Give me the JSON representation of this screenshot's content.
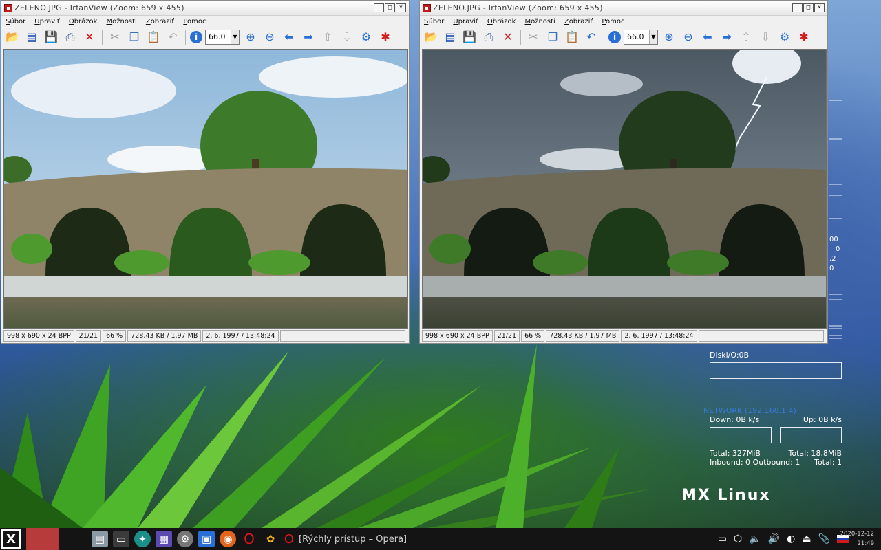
{
  "windows": [
    {
      "id": "left",
      "title": "ZELENO.JPG - IrfanView (Zoom: 659 x 455)",
      "menu": [
        "Súbor",
        "Upraviť",
        "Obrázok",
        "Možnosti",
        "Zobraziť",
        "Pomoc"
      ],
      "zoom_value": "66.0",
      "status": [
        "998 x 690 x 24 BPP",
        "21/21",
        "66 %",
        "728.43 KB / 1.97 MB",
        "2. 6. 1997 / 13:48:24"
      ]
    },
    {
      "id": "right",
      "title": "ZELENO.JPG - IrfanView (Zoom: 659 x 455)",
      "menu": [
        "Súbor",
        "Upraviť",
        "Obrázok",
        "Možnosti",
        "Zobraziť",
        "Pomoc"
      ],
      "zoom_value": "66.0",
      "status": [
        "998 x 690 x 24 BPP",
        "21/21",
        "66 %",
        "728.43 KB / 1.97 MB",
        "2. 6. 1997 / 13:48:24"
      ]
    }
  ],
  "toolbar_icons": [
    "open-icon",
    "slideshow-icon",
    "save-icon",
    "print-icon",
    "delete-icon",
    "cut-icon",
    "copy-icon",
    "paste-icon",
    "undo-icon",
    "info-icon",
    "zoom-in-icon",
    "zoom-out-icon",
    "previous-icon",
    "next-icon",
    "page-up-icon",
    "page-down-icon",
    "settings-icon",
    "irfanview-icon"
  ],
  "conky": {
    "disk": "Diskl/O:0B",
    "network": "NETWORK (192.168.1.4)",
    "down": "Down: 0B   k/s",
    "up": "Up: 0B   k/s",
    "total_down": "Total: 327MiB",
    "total_up": "Total: 18,8MiB",
    "inbound": "Inbound: 0 Outbound: 1",
    "total": "Total: 1",
    "side_numbers": [
      "00",
      "0",
      ",2",
      "0"
    ]
  },
  "logo": "MX Linux",
  "taskbar": {
    "active_app": "[Rýchly prístup – Opera]",
    "date": "2020-12-12",
    "time": "21:49"
  },
  "colors": {
    "taskbar": "#141414",
    "red_block": "#b83b3b",
    "network_title": "#3a7ad6"
  }
}
